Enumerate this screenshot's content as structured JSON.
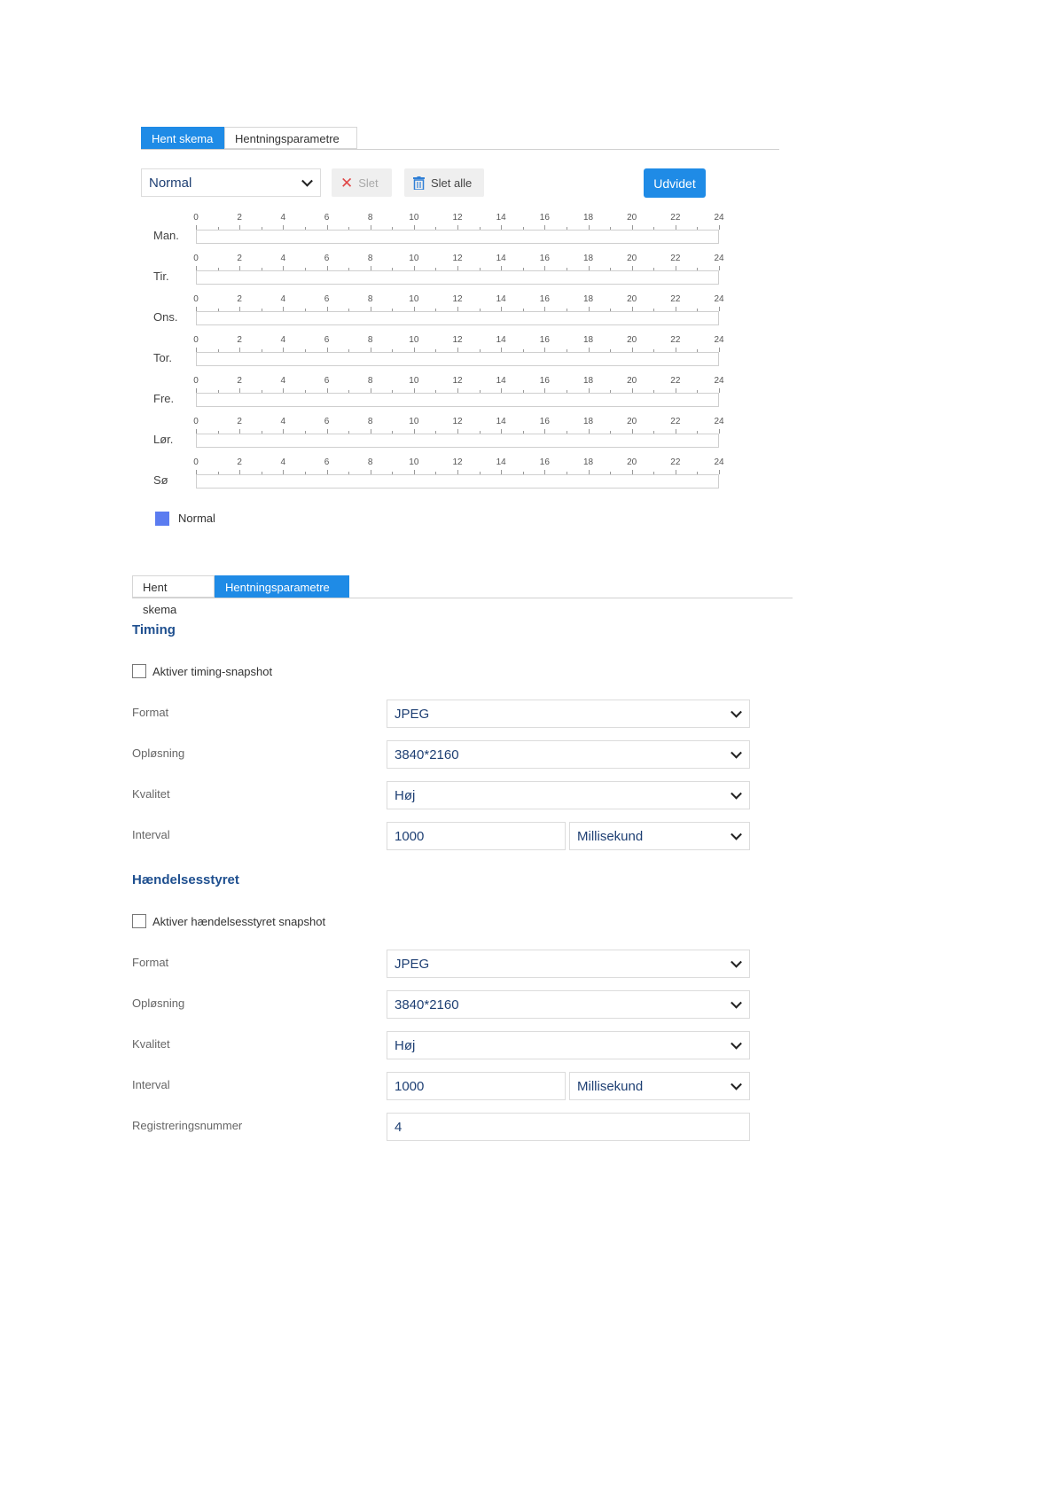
{
  "schedule_tabs": {
    "tab1": "Hent skema",
    "tab2": "Hentningsparametre"
  },
  "toolbar": {
    "type_select": "Normal",
    "delete_label": "Slet",
    "delete_all_label": "Slet alle",
    "advanced_label": "Udvidet"
  },
  "schedule": {
    "days": [
      "Man.",
      "Tir.",
      "Ons.",
      "Tor.",
      "Fre.",
      "Lør.",
      "Sø"
    ],
    "hour_ticks": [
      "0",
      "2",
      "4",
      "6",
      "8",
      "10",
      "12",
      "14",
      "16",
      "18",
      "20",
      "22",
      "24"
    ]
  },
  "legend": {
    "label": "Normal",
    "color": "#5b7cf0"
  },
  "params_tabs": {
    "tab1": "Hent skema",
    "tab2": "Hentningsparametre"
  },
  "timing": {
    "title": "Timing",
    "enable_label": "Aktiver timing-snapshot",
    "format_label": "Format",
    "format_value": "JPEG",
    "resolution_label": "Opløsning",
    "resolution_value": "3840*2160",
    "quality_label": "Kvalitet",
    "quality_value": "Høj",
    "interval_label": "Interval",
    "interval_value": "1000",
    "interval_unit": "Millisekund"
  },
  "event": {
    "title": "Hændelsesstyret",
    "enable_label": "Aktiver hændelsesstyret snapshot",
    "format_label": "Format",
    "format_value": "JPEG",
    "resolution_label": "Opløsning",
    "resolution_value": "3840*2160",
    "quality_label": "Kvalitet",
    "quality_value": "Høj",
    "interval_label": "Interval",
    "interval_value": "1000",
    "interval_unit": "Millisekund",
    "capture_number_label": "Registreringsnummer",
    "capture_number_value": "4"
  }
}
